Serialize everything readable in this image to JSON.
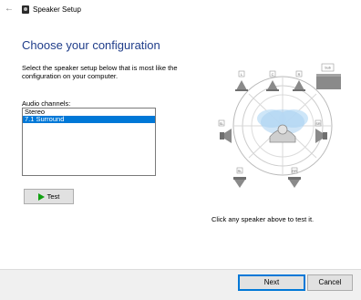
{
  "window": {
    "title": "Speaker Setup"
  },
  "page": {
    "heading": "Choose your configuration",
    "instruction": "Select the speaker setup below that is most like the configuration on your computer.",
    "audio_channels_label": "Audio channels:",
    "channels": [
      {
        "label": "Stereo",
        "selected": false
      },
      {
        "label": "7.1 Surround",
        "selected": true
      }
    ],
    "test_button": "Test",
    "hint": "Click any speaker above to test it."
  },
  "speakers": {
    "front_left": "L",
    "center": "C",
    "front_right": "R",
    "subwoofer": "Sub",
    "side_left": "SL",
    "side_right": "SR",
    "rear_left": "RL",
    "rear_right": "RR"
  },
  "footer": {
    "next": "Next",
    "cancel": "Cancel"
  },
  "colors": {
    "heading": "#1f3d8a",
    "selection": "#0078d7",
    "play": "#10a010",
    "speaker": "#8a8a8a"
  }
}
